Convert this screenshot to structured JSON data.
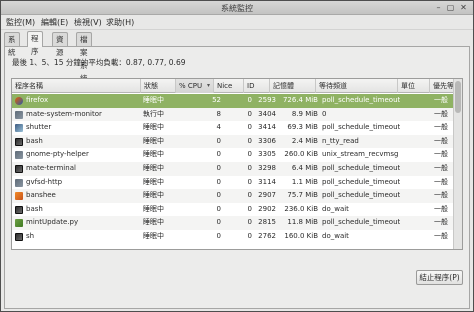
{
  "window": {
    "title": "系統監控",
    "controls": {
      "minimize": "–",
      "maximize": "▢",
      "close": "✕"
    }
  },
  "menu": [
    "監控(M)",
    "編輯(E)",
    "檢視(V)",
    "求助(H)"
  ],
  "tabs": [
    "系統",
    "程序",
    "資源",
    "檔案系統"
  ],
  "active_tab": "程序",
  "load_average": "最後 1、5、15 分鐘的平均負載：0.87, 0.77, 0.69",
  "table": {
    "columns": [
      "程序名稱",
      "狀態",
      "% CPU",
      "Nice",
      "ID",
      "記憶體",
      "等待頻道",
      "單位",
      "優先等級"
    ],
    "sorted_column": "% CPU",
    "sort_indicator": "▾",
    "rows": [
      {
        "name": "firefox",
        "status": "睡眠中",
        "cpu": "52",
        "nice": "0",
        "id": "2593",
        "memory": "726.4 MiB",
        "wait": "poll_schedule_timeout",
        "unit": "",
        "priority": "一般",
        "icon": "firefox-icon",
        "selected": true
      },
      {
        "name": "mate-system-monitor",
        "status": "執行中",
        "cpu": "8",
        "nice": "0",
        "id": "3404",
        "memory": "8.9 MiB",
        "wait": "0",
        "unit": "",
        "priority": "一般",
        "icon": "generic-app-icon"
      },
      {
        "name": "shutter",
        "status": "睡眠中",
        "cpu": "4",
        "nice": "0",
        "id": "3414",
        "memory": "69.3 MiB",
        "wait": "poll_schedule_timeout",
        "unit": "",
        "priority": "一般",
        "icon": "shutter-icon"
      },
      {
        "name": "bash",
        "status": "睡眠中",
        "cpu": "0",
        "nice": "0",
        "id": "3306",
        "memory": "2.4 MiB",
        "wait": "n_tty_read",
        "unit": "",
        "priority": "一般",
        "icon": "terminal-icon"
      },
      {
        "name": "gnome-pty-helper",
        "status": "睡眠中",
        "cpu": "0",
        "nice": "0",
        "id": "3305",
        "memory": "260.0 KiB",
        "wait": "unix_stream_recvmsg",
        "unit": "",
        "priority": "一般",
        "icon": "generic-app-icon"
      },
      {
        "name": "mate-terminal",
        "status": "睡眠中",
        "cpu": "0",
        "nice": "0",
        "id": "3298",
        "memory": "6.4 MiB",
        "wait": "poll_schedule_timeout",
        "unit": "",
        "priority": "一般",
        "icon": "terminal-icon"
      },
      {
        "name": "gvfsd-http",
        "status": "睡眠中",
        "cpu": "0",
        "nice": "0",
        "id": "3114",
        "memory": "1.1 MiB",
        "wait": "poll_schedule_timeout",
        "unit": "",
        "priority": "一般",
        "icon": "generic-app-icon"
      },
      {
        "name": "banshee",
        "status": "睡眠中",
        "cpu": "0",
        "nice": "0",
        "id": "2907",
        "memory": "75.7 MiB",
        "wait": "poll_schedule_timeout",
        "unit": "",
        "priority": "一般",
        "icon": "banshee-icon"
      },
      {
        "name": "bash",
        "status": "睡眠中",
        "cpu": "0",
        "nice": "0",
        "id": "2902",
        "memory": "236.0 KiB",
        "wait": "do_wait",
        "unit": "",
        "priority": "一般",
        "icon": "terminal-icon"
      },
      {
        "name": "mintUpdate.py",
        "status": "睡眠中",
        "cpu": "0",
        "nice": "0",
        "id": "2815",
        "memory": "11.8 MiB",
        "wait": "poll_schedule_timeout",
        "unit": "",
        "priority": "一般",
        "icon": "update-icon"
      },
      {
        "name": "sh",
        "status": "睡眠中",
        "cpu": "0",
        "nice": "0",
        "id": "2762",
        "memory": "160.0 KiB",
        "wait": "do_wait",
        "unit": "",
        "priority": "一般",
        "icon": "terminal-icon"
      }
    ]
  },
  "end_process_button": "結止程序(P)",
  "colors": {
    "selected_row": "#8fb263",
    "window_bg": "#e8e8e7"
  }
}
